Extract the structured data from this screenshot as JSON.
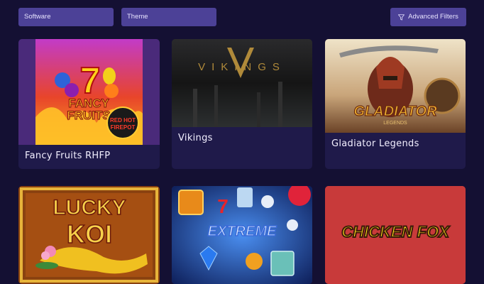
{
  "filters": {
    "software_label": "Software",
    "theme_label": "Theme",
    "advanced_label": "Advanced Filters",
    "advanced_icon": "filter-funnel-icon"
  },
  "games": [
    {
      "title": "Fancy Fruits RHFP",
      "art_text": [
        "7",
        "FANCY",
        "FRUITS",
        "RED HOT",
        "FIREPOT"
      ]
    },
    {
      "title": "Vikings",
      "art_text": [
        "VIKINGS"
      ]
    },
    {
      "title": "Gladiator Legends",
      "art_text": [
        "GLADIATOR",
        "LEGENDS"
      ]
    },
    {
      "title": "",
      "art_text": [
        "LUCKY",
        "KOI"
      ]
    },
    {
      "title": "",
      "art_text": [
        "EXTREME",
        "7"
      ]
    },
    {
      "title": "",
      "art_text": [
        "CHICKEN FOX"
      ]
    }
  ],
  "colors": {
    "background": "#141033",
    "card": "#1f1a4a",
    "filter_button": "#4c4197",
    "chicken_fox_bg": "#c83a3a"
  }
}
